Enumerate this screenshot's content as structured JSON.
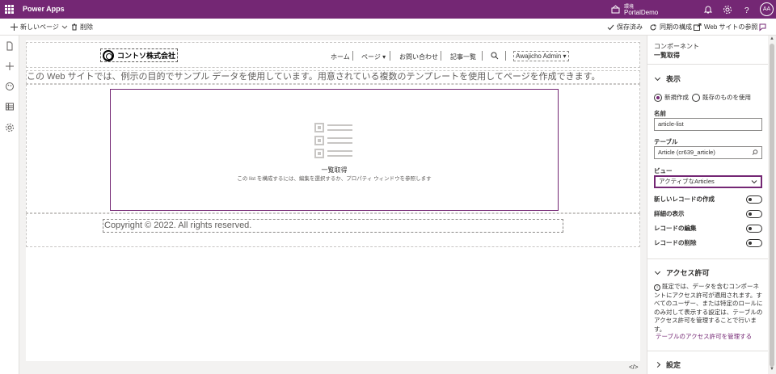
{
  "app": {
    "title": "Power Apps"
  },
  "environment": {
    "label": "環境",
    "name": "PortalDemo"
  },
  "user": {
    "initials": "AA"
  },
  "toolbar": {
    "new_page": "新しいページ",
    "delete": "削除",
    "saved": "保存済み",
    "sync": "同期の構成",
    "browse": "Web サイトの参照"
  },
  "site": {
    "logo_text": "コントソ株式会社",
    "nav": [
      "ホーム",
      "ページ",
      "お問い合わせ",
      "記事一覧"
    ],
    "user_menu": "Awajicho Admin",
    "intro": "この Web サイトでは、例示の目的でサンプル データを使用しています。用意されている複数のテンプレートを使用してページを作成できます。",
    "list_title": "一覧取得",
    "list_desc": "この list を構成するには、編集を選択するか、プロパティ ウィンドウを参照します",
    "copyright": "Copyright © 2022. All rights reserved."
  },
  "panel": {
    "component_label": "コンポーネント",
    "component_name": "一覧取得",
    "display_section": "表示",
    "radio_new": "新規作成",
    "radio_existing": "既存のものを使用",
    "name_label": "名前",
    "name_value": "article-list",
    "table_label": "テーブル",
    "table_value": "Article (cr639_article)",
    "view_label": "ビュー",
    "view_value": "アクティブなArticles",
    "toggles": [
      "新しいレコードの作成",
      "詳細の表示",
      "レコードの編集",
      "レコードの削除"
    ],
    "access_section": "アクセス許可",
    "access_text": "既定では、データを含むコンポーネントにアクセス許可が適用されます。すべてのユーザー、または特定のロールにのみ対して表示する設定は、テーブルのアクセス許可を管理することで行います。",
    "access_link": "テーブルのアクセス許可を管理する",
    "settings_section": "設定"
  },
  "colors": {
    "brand": "#742774"
  }
}
